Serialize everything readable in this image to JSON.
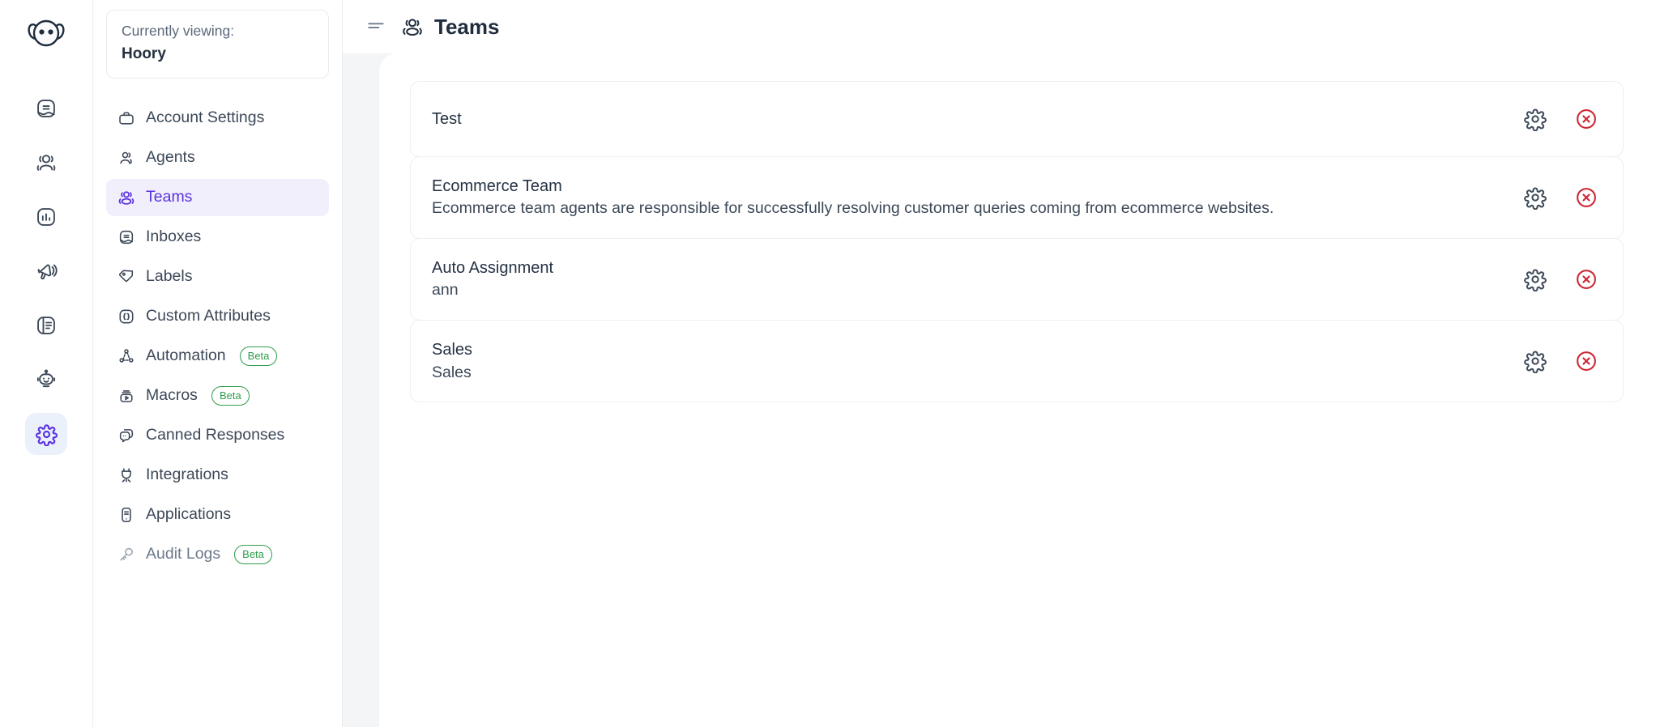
{
  "rail": {
    "brand_icon": "hoory-logo-icon",
    "items": [
      {
        "name": "conversations",
        "icon": "chat-inbox-icon",
        "active": false
      },
      {
        "name": "contacts",
        "icon": "contacts-icon",
        "active": false
      },
      {
        "name": "reports",
        "icon": "bar-chart-icon",
        "active": false
      },
      {
        "name": "campaigns",
        "icon": "megaphone-icon",
        "active": false
      },
      {
        "name": "knowledge-base",
        "icon": "document-icon",
        "active": false
      },
      {
        "name": "assistant",
        "icon": "robot-icon",
        "active": false
      },
      {
        "name": "settings",
        "icon": "gear-icon",
        "active": true
      }
    ]
  },
  "sidebar": {
    "viewing_label": "Currently viewing:",
    "account_name": "Hoory",
    "items": [
      {
        "label": "Account Settings",
        "icon": "briefcase-icon",
        "badge": null,
        "active": false,
        "muted": false
      },
      {
        "label": "Agents",
        "icon": "agent-icon",
        "badge": null,
        "active": false,
        "muted": false
      },
      {
        "label": "Teams",
        "icon": "teams-icon",
        "badge": null,
        "active": true,
        "muted": false
      },
      {
        "label": "Inboxes",
        "icon": "inbox-icon",
        "badge": null,
        "active": false,
        "muted": false
      },
      {
        "label": "Labels",
        "icon": "label-tag-icon",
        "badge": null,
        "active": false,
        "muted": false
      },
      {
        "label": "Custom Attributes",
        "icon": "braces-icon",
        "badge": null,
        "active": false,
        "muted": false
      },
      {
        "label": "Automation",
        "icon": "automation-flow-icon",
        "badge": "Beta",
        "active": false,
        "muted": false
      },
      {
        "label": "Macros",
        "icon": "macro-icon",
        "badge": "Beta",
        "active": false,
        "muted": false
      },
      {
        "label": "Canned Responses",
        "icon": "canned-response-icon",
        "badge": null,
        "active": false,
        "muted": false
      },
      {
        "label": "Integrations",
        "icon": "plug-icon",
        "badge": null,
        "active": false,
        "muted": false
      },
      {
        "label": "Applications",
        "icon": "applications-icon",
        "badge": null,
        "active": false,
        "muted": false
      },
      {
        "label": "Audit Logs",
        "icon": "key-icon",
        "badge": "Beta",
        "active": false,
        "muted": true
      }
    ]
  },
  "header": {
    "menu_icon": "hamburger-icon",
    "title_icon": "teams-icon",
    "title": "Teams"
  },
  "teams": [
    {
      "name": "Test",
      "description": ""
    },
    {
      "name": "Ecommerce Team",
      "description": "Ecommerce team agents are responsible for successfully resolving customer queries coming from ecommerce websites."
    },
    {
      "name": "Auto Assignment",
      "description": "ann"
    },
    {
      "name": "Sales",
      "description": "Sales"
    }
  ],
  "row_actions": {
    "settings_icon": "gear-icon",
    "delete_icon": "circle-x-icon"
  },
  "colors": {
    "accent": "#5a32e0",
    "active_bg": "#f1effb",
    "rail_active_bg": "#eaf1fb",
    "text": "#3c4858",
    "heading": "#1f2d3d",
    "page_bg": "#f4f5f7",
    "danger": "#cc2936",
    "beta_green": "#2e9c4a"
  }
}
